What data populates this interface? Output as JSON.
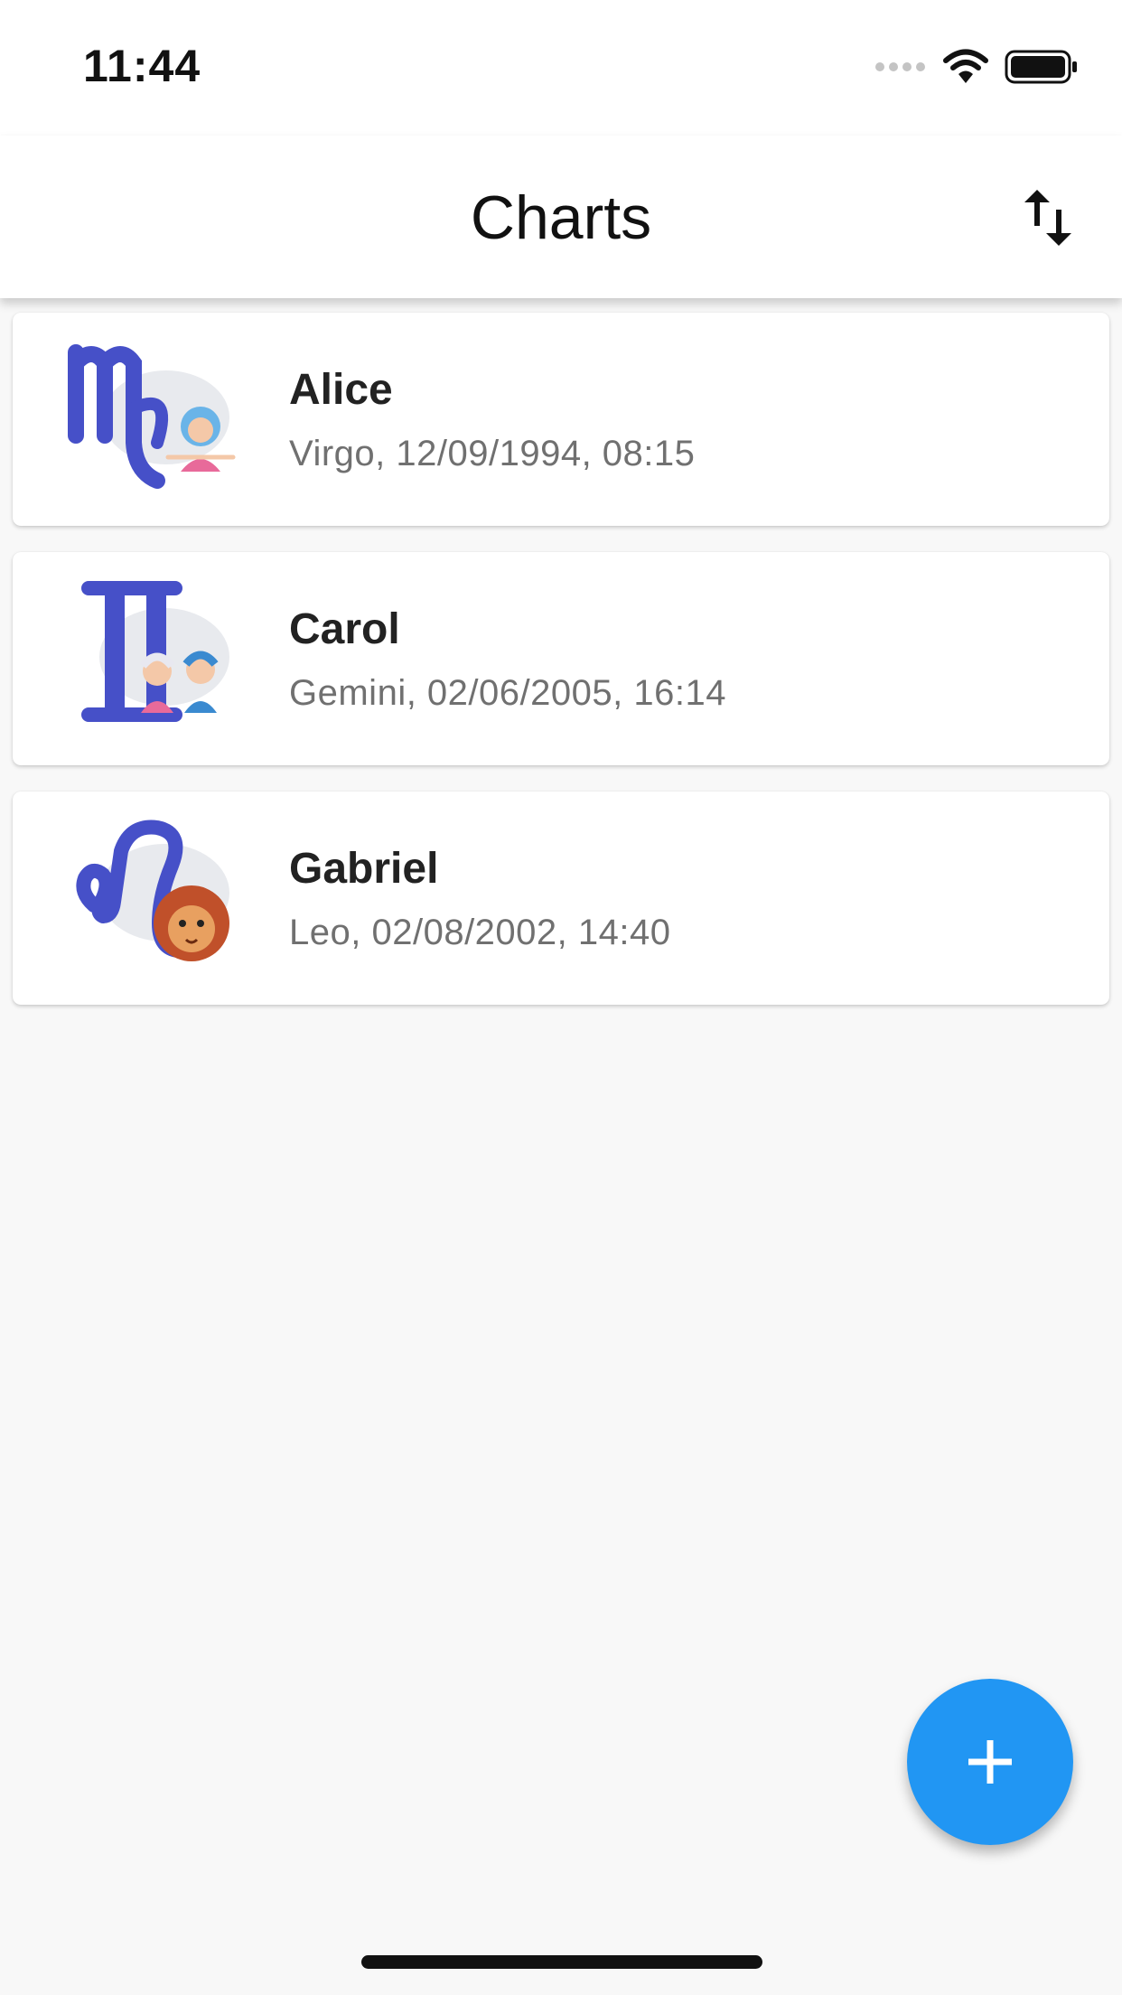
{
  "status_bar": {
    "time": "11:44",
    "icons": [
      "signal-dots-icon",
      "wifi-icon",
      "battery-icon"
    ]
  },
  "app_bar": {
    "title": "Charts",
    "sort_icon": "sort-arrows-icon"
  },
  "charts": [
    {
      "name": "Alice",
      "detail": "Virgo, 12/09/1994, 08:15",
      "sign": "Virgo"
    },
    {
      "name": "Carol",
      "detail": "Gemini, 02/06/2005, 16:14",
      "sign": "Gemini"
    },
    {
      "name": "Gabriel",
      "detail": "Leo, 02/08/2002, 14:40",
      "sign": "Leo"
    }
  ],
  "fab": {
    "icon": "plus-icon"
  },
  "colors": {
    "accent": "#2196f3",
    "glyph": "#4650c8",
    "background": "#f8f8f8"
  }
}
